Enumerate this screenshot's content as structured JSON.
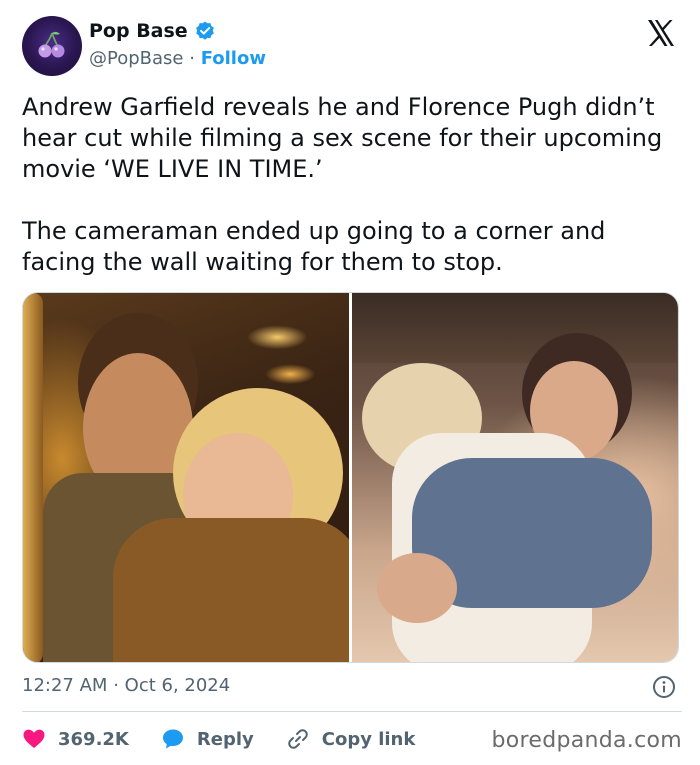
{
  "author": {
    "display_name": "Pop Base",
    "handle": "@PopBase",
    "separator": "·",
    "follow_label": "Follow",
    "avatar_icon": "cherry-icon",
    "verified_icon": "verified-badge-icon",
    "verified_color": "#1d9bf0"
  },
  "platform_icon": "x-logo-icon",
  "tweet": {
    "paragraphs": [
      "Andrew Garfield reveals he and Florence Pugh didn’t hear cut while filming a sex scene for their upcoming movie ‘WE LIVE IN TIME.’",
      "The cameraman ended up going to a corner and facing the wall waiting for them to stop."
    ]
  },
  "media": [
    {
      "kind": "photo",
      "icon": "photo-left"
    },
    {
      "kind": "photo",
      "icon": "photo-right"
    }
  ],
  "meta": {
    "time": "12:27 AM",
    "separator": "·",
    "date": "Oct 6, 2024",
    "info_icon": "info-icon"
  },
  "actions": {
    "likes": "369.2K",
    "like_icon": "heart-icon",
    "like_color": "#f91880",
    "reply_label": "Reply",
    "reply_icon": "speech-bubble-icon",
    "reply_color": "#1d9bf0",
    "copy_link_label": "Copy link",
    "copy_link_icon": "link-icon"
  },
  "watermark": "boredpanda.com",
  "colors": {
    "accent": "#1d9bf0",
    "text": "#0f1419",
    "secondary_text": "#536471",
    "border": "#cfd9de"
  }
}
